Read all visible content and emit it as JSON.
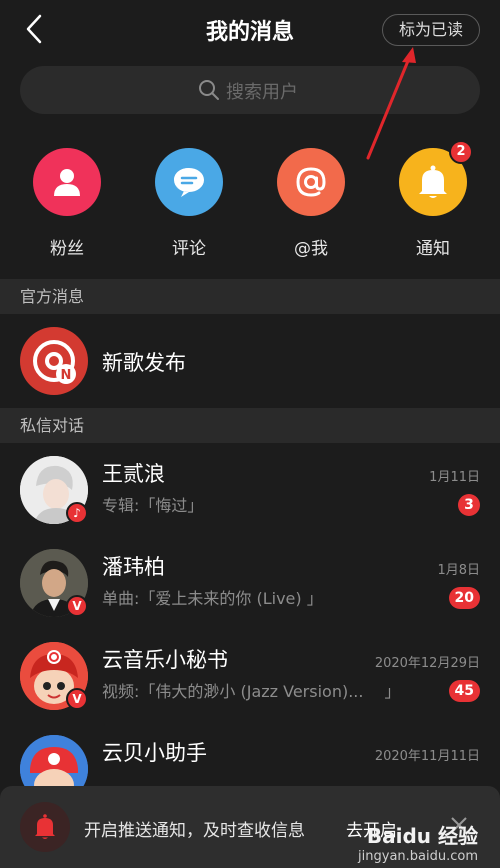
{
  "header": {
    "title": "我的消息",
    "mark_read": "标为已读"
  },
  "search": {
    "placeholder": "搜索用户"
  },
  "categories": [
    {
      "label": "粉丝",
      "color": "#f0325a",
      "icon": "user-icon"
    },
    {
      "label": "评论",
      "color": "#4aa8e6",
      "icon": "comment-icon"
    },
    {
      "label": "@我",
      "color": "#f26a4b",
      "icon": "at-icon"
    },
    {
      "label": "通知",
      "color": "#f7b31c",
      "icon": "bell-icon",
      "badge": "2"
    }
  ],
  "sections": {
    "official": "官方消息",
    "private": "私信对话"
  },
  "official": {
    "name": "新歌发布",
    "color": "#d33a31"
  },
  "conversations": [
    {
      "name": "王贰浪",
      "preview": "专辑:「悔过」",
      "time": "1月11日",
      "count": "3"
    },
    {
      "name": "潘玮柏",
      "preview": "单曲:「爱上未来的你 (Live) 」",
      "time": "1月8日",
      "count": "20"
    },
    {
      "name": "云音乐小秘书",
      "preview": "视频:「伟大的渺小 (Jazz Version)...　 」",
      "time": "2020年12月29日",
      "count": "45"
    },
    {
      "name": "云贝小助手",
      "preview": "",
      "time": "2020年11月11日",
      "count": ""
    }
  ],
  "toast": {
    "text": "开启推送通知，及时查收信息",
    "action": "去开启"
  },
  "watermark": {
    "logo": "Baidu 经验",
    "url": "jingyan.baidu.com"
  },
  "colors": {
    "accent": "#e83235",
    "background": "#1c1c1c",
    "annotation_arrow": "#e0262b"
  }
}
